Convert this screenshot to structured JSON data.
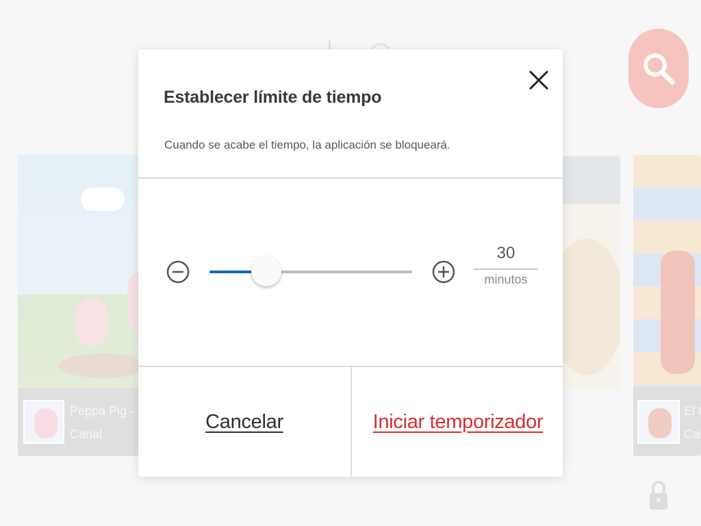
{
  "background": {
    "cards": [
      {
        "title": "Peppa Pig -",
        "subtitle": "Canal"
      },
      {
        "title": "El C",
        "subtitle": "Can"
      }
    ]
  },
  "dialog": {
    "title": "Establecer límite de tiempo",
    "description": "Cuando se acabe el tiempo, la aplicación se bloqueará.",
    "timer": {
      "value": "30",
      "unit": "minutos",
      "slider_fraction": 0.28
    },
    "buttons": {
      "cancel": "Cancelar",
      "start": "Iniciar temporizador"
    }
  },
  "colors": {
    "accent_blue": "#1565c0",
    "start_red": "#d32f2f",
    "search_fab": "#ef9a90"
  },
  "icons": {
    "close": "close-icon",
    "minus": "minus-circle-icon",
    "plus": "plus-circle-icon",
    "search": "search-icon",
    "lock": "lock-icon"
  }
}
